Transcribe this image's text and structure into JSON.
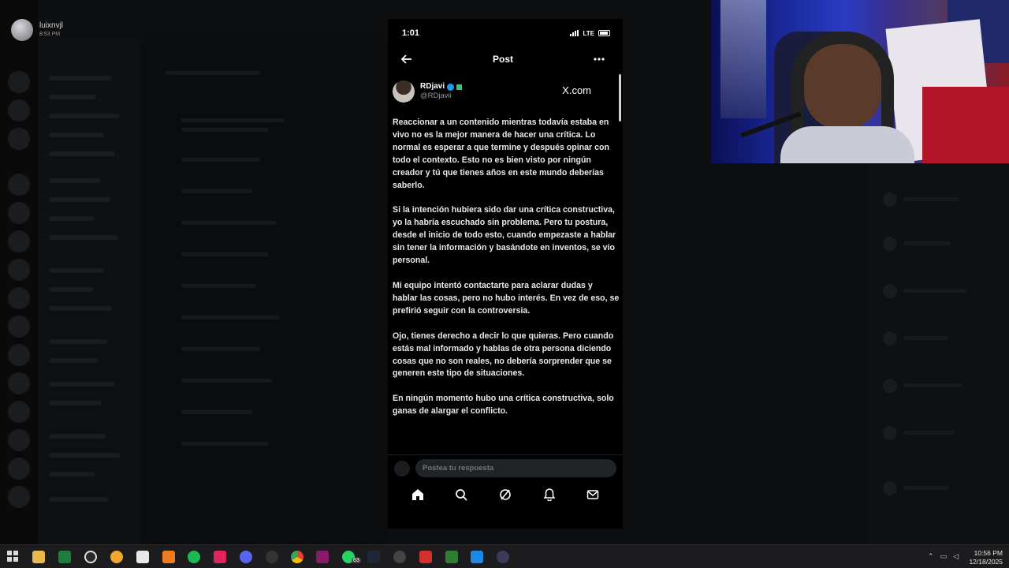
{
  "user_chip": {
    "name": "luixnvjl",
    "time": "8:53 PM"
  },
  "phone": {
    "status": {
      "time": "1:01",
      "network": "LTE"
    },
    "header": {
      "title": "Post"
    },
    "author": {
      "display_name": "RDjavi",
      "handle": "@RDjavii",
      "source": "X.com"
    },
    "paragraphs": [
      "Reaccionar a un contenido mientras todavía estaba en vivo no es la mejor manera de hacer una crítica. Lo normal es esperar a que termine y después opinar con todo el contexto. Esto no es bien visto por ningún creador y tú que tienes años en este mundo deberías saberlo.",
      "Si la intención hubiera sido dar una crítica constructiva, yo la habría escuchado sin problema. Pero tu postura, desde el inicio de todo esto, cuando empezaste a hablar sin tener la información y basándote en inventos, se vio personal.",
      "Mi equipo intentó contactarte para aclarar dudas y hablar las cosas, pero no hubo interés. En vez de eso, se prefirió seguir con la controversia.",
      "Ojo, tienes derecho a decir lo que quieras. Pero cuando estás mal informado y hablas de otra persona diciendo cosas que no son reales, no debería sorprender que se generen este tipo de situaciones.",
      "En ningún momento hubo una crítica constructiva, solo ganas de alargar el conflicto."
    ],
    "reply_placeholder": "Postea tu respuesta",
    "nav": [
      "home-icon",
      "search-icon",
      "grok-icon",
      "notifications-icon",
      "messages-icon"
    ]
  },
  "taskbar": {
    "time": "10:56 PM",
    "date": "12/18/2025",
    "whatsapp_badge": "63"
  },
  "colors": {
    "accent": "#1d9bf0",
    "background": "#000000",
    "text": "#e7e9ea",
    "muted": "#71767b"
  }
}
